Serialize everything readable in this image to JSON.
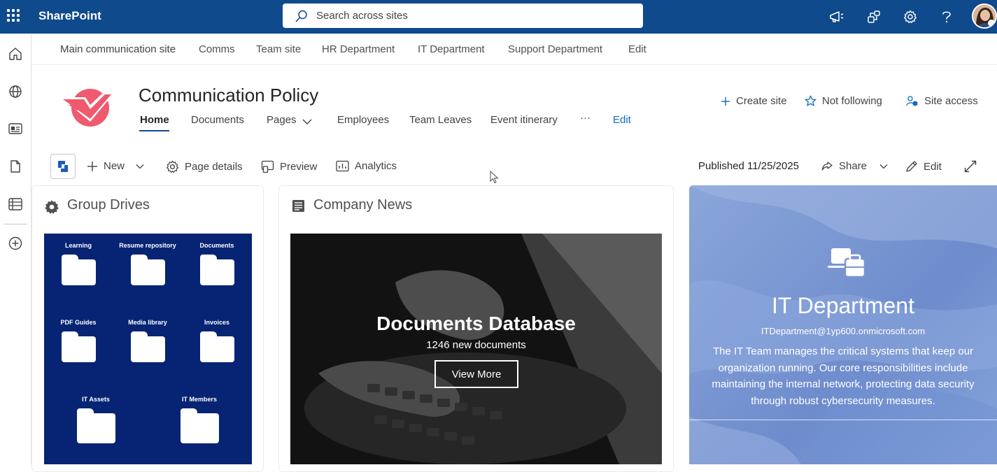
{
  "app": {
    "name": "SharePoint"
  },
  "search": {
    "placeholder": "Search across sites"
  },
  "hub_nav": [
    "Main communication site",
    "Comms",
    "Team site",
    "HR Department",
    "IT Department",
    "Support Department",
    "Edit"
  ],
  "site": {
    "title": "Communication Policy",
    "nav": [
      "Home",
      "Documents",
      "Pages",
      "Employees",
      "Team Leaves",
      "Event itinerary",
      "···",
      "Edit"
    ],
    "actions": [
      "Create site",
      "Not following",
      "Site access"
    ]
  },
  "command_bar": {
    "new_label": "New",
    "page_details_label": "Page details",
    "preview_label": "Preview",
    "analytics_label": "Analytics",
    "published": "Published 11/25/2025",
    "share_label": "Share",
    "edit_label": "Edit"
  },
  "group_drives": {
    "title": "Group Drives",
    "folders": [
      "Learning",
      "Resume repository",
      "Documents",
      "PDF Guides",
      "Media library",
      "Invoices",
      "IT Assets",
      "IT Members"
    ]
  },
  "company_news": {
    "title": "Company News",
    "headline": "Documents Database",
    "subtitle": "1246 new documents",
    "button_label": "View More"
  },
  "it_department": {
    "title": "IT Department",
    "email": "ITDepartment@1yp600.onmicrosoft.com",
    "description": "The IT Team manages the critical systems that keep our organization running. Our core responsibilities include maintaining the internal network, protecting data security through robust cybersecurity measures."
  },
  "colors": {
    "suite_bar": "#0f4a8c",
    "drives_background": "#062473",
    "logo_accent": "#ef5a6e",
    "it_panel": "#7a97d3"
  }
}
